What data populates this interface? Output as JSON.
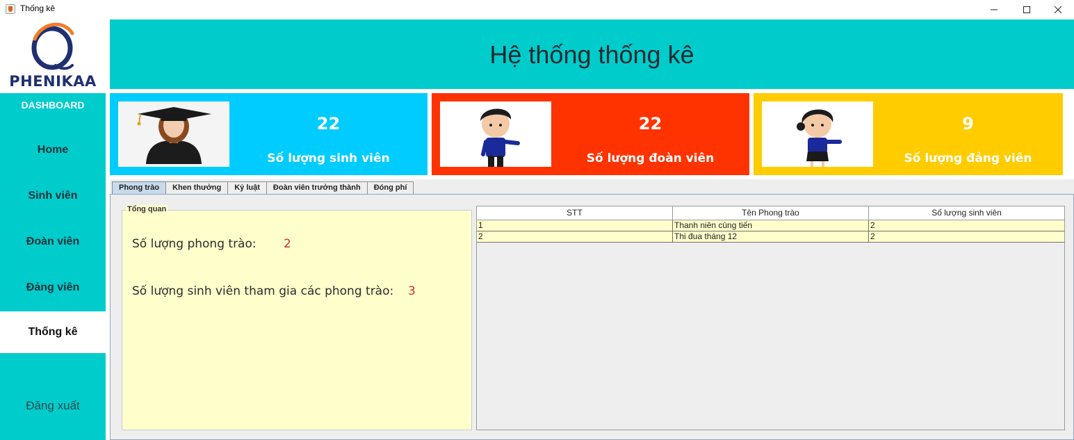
{
  "window": {
    "title": "Thống kê",
    "controls": [
      "minimize-icon",
      "maximize-icon",
      "close-icon"
    ]
  },
  "logo": {
    "text": "PHENIKAA"
  },
  "header": {
    "title": "Hệ thống thống kê"
  },
  "sidebar": {
    "heading": "DASHBOARD",
    "items": [
      {
        "label": "Home"
      },
      {
        "label": "Sinh viên"
      },
      {
        "label": "Đoàn viên"
      },
      {
        "label": "Đảng viên"
      },
      {
        "label": "Thống kê"
      }
    ],
    "active": "Thống kê",
    "logout": "Đăng xuất"
  },
  "cards": [
    {
      "value": "22",
      "label": "Số lượng sinh viên",
      "color": "#00ccff",
      "icon": "graduate-girl-icon"
    },
    {
      "value": "22",
      "label": "Số lượng đoàn viên",
      "color": "#ff3300",
      "icon": "boy-uniform-icon"
    },
    {
      "value": "9",
      "label": "Số lượng đảng viên",
      "color": "#ffcc00",
      "icon": "girl-uniform-icon"
    }
  ],
  "tabs": [
    {
      "label": "Phong trào"
    },
    {
      "label": "Khen thưởng"
    },
    {
      "label": "Kỷ luật"
    },
    {
      "label": "Đoàn viên trưởng thành"
    },
    {
      "label": "Đóng phí"
    }
  ],
  "active_tab": "Phong trào",
  "overview": {
    "legend": "Tổng quan",
    "movements_label": "Số lượng phong trào:",
    "movements_value": "2",
    "participants_label": "Số lượng sinh viên tham gia các phong trào:",
    "participants_value": "3"
  },
  "table": {
    "columns": [
      "STT",
      "Tên Phong trào",
      "Số lượng sinh viên"
    ],
    "rows": [
      [
        "1",
        "Thanh niên cùng tiến",
        "2"
      ],
      [
        "2",
        "Thi đua tháng 12",
        "2"
      ]
    ]
  },
  "colors": {
    "teal": "#00cccc",
    "card_blue": "#00ccff",
    "card_red": "#ff3300",
    "card_yellow": "#ffcc00",
    "overview_bg": "#ffffcc",
    "value_red": "#d03030"
  }
}
